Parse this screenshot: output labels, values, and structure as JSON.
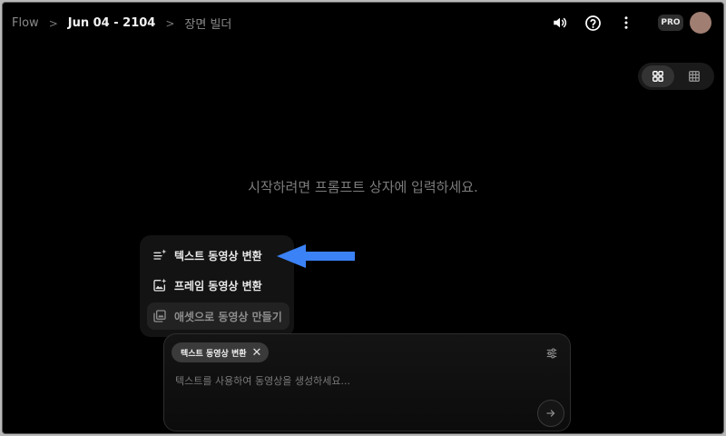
{
  "header": {
    "breadcrumbs": [
      "Flow",
      "Jun 04 - 2104",
      "장면 빌더"
    ],
    "separator": ">",
    "pro_label": "PRO"
  },
  "icons": {
    "volume": "speaker-icon",
    "help": "help-circle-icon",
    "more": "more-vertical-icon",
    "grid_view": "grid-icon",
    "table_view": "table-icon",
    "settings": "sliders-icon",
    "send": "arrow-right-icon"
  },
  "main": {
    "empty_message": "시작하려면 프롬프트 상자에 입력하세요."
  },
  "mode_menu": {
    "items": [
      {
        "label": "텍스트 동영상 변환",
        "icon": "text-sparkle-icon"
      },
      {
        "label": "프레임 동영상 변환",
        "icon": "image-sparkle-icon"
      },
      {
        "label": "애셋으로 동영상 만들기",
        "icon": "assets-icon"
      }
    ]
  },
  "composer": {
    "chip_label": "텍스트 동영상 변환",
    "placeholder": "텍스트를 사용하여 동영상을 생성하세요..."
  },
  "colors": {
    "background": "#000000",
    "arrow": "#3b82f6",
    "avatar": "#a07e72"
  }
}
